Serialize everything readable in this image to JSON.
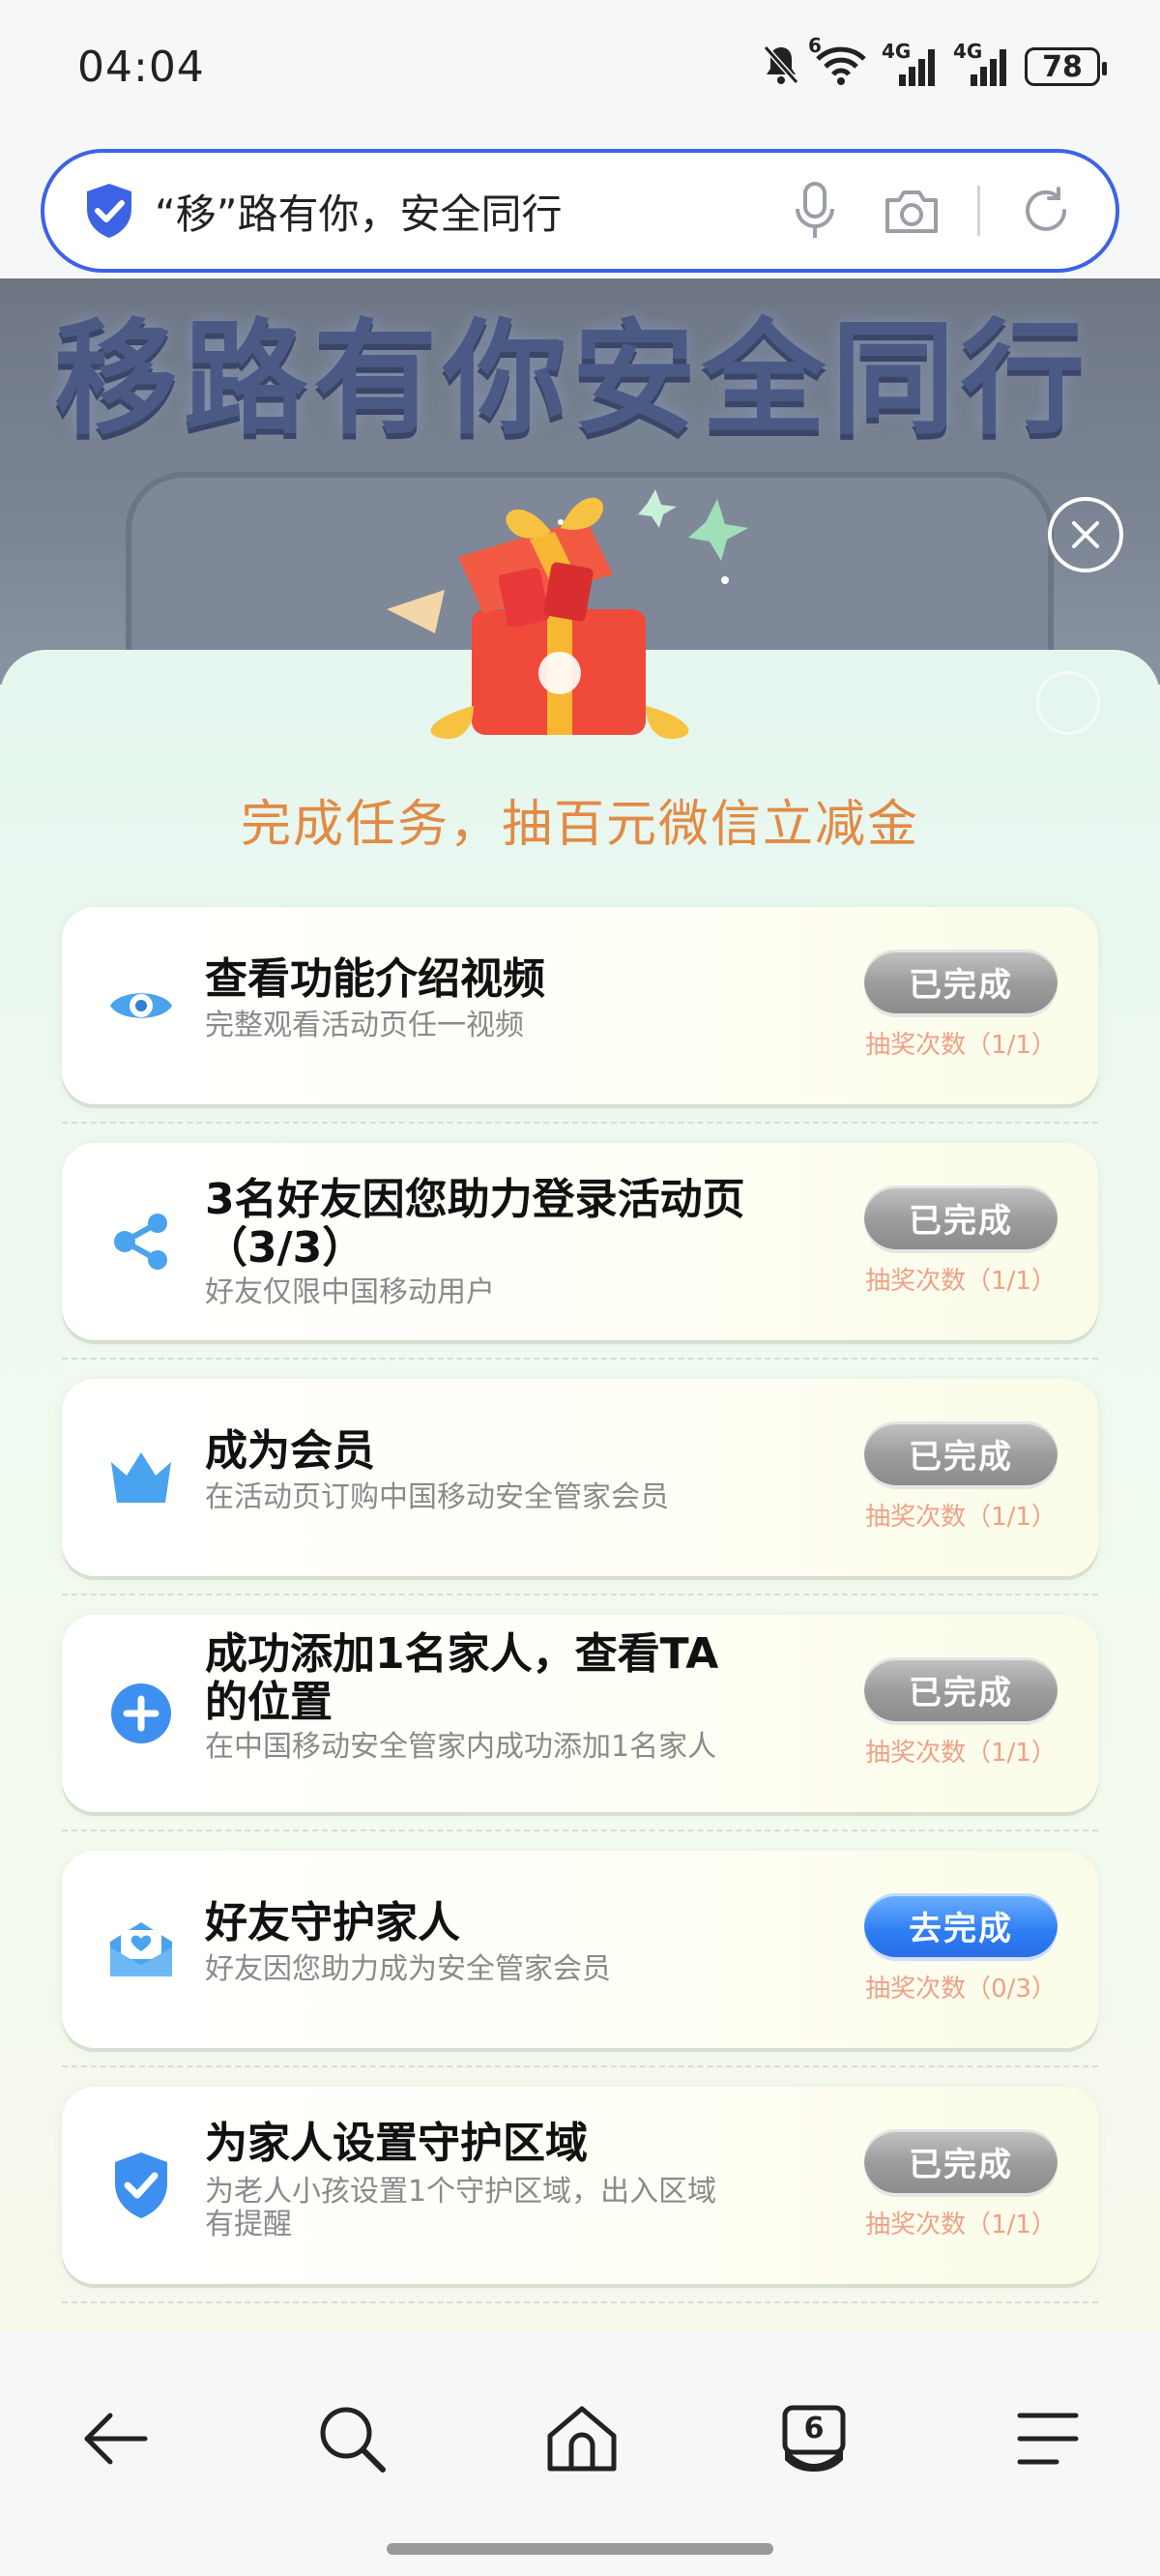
{
  "status_bar": {
    "time": "04:04",
    "network_1": "4G",
    "network_2": "4G",
    "wifi_badge": "6",
    "battery": "78"
  },
  "search": {
    "text": "“移”路有你，安全同行",
    "icons": [
      "shield-icon",
      "microphone-icon",
      "camera-icon",
      "refresh-icon"
    ]
  },
  "hero": {
    "banner_text": "移路有你安全同行"
  },
  "panel": {
    "title": "完成任务，抽百元微信立减金",
    "tasks": [
      {
        "icon": "eye-icon",
        "title": "查看功能介绍视频",
        "subtitle": "完整观看活动页任一视频",
        "button": "已完成",
        "state": "done",
        "count": "抽奖次数（1/1）"
      },
      {
        "icon": "share-icon",
        "title": "3名好友因您助力登录活动页（3/3）",
        "subtitle": "好友仅限中国移动用户",
        "button": "已完成",
        "state": "done",
        "count": "抽奖次数（1/1）"
      },
      {
        "icon": "crown-icon",
        "title": "成为会员",
        "subtitle": "在活动页订购中国移动安全管家会员",
        "button": "已完成",
        "state": "done",
        "count": "抽奖次数（1/1）"
      },
      {
        "icon": "plus-icon",
        "title": "成功添加1名家人，查看TA的位置",
        "subtitle": "在中国移动安全管家内成功添加1名家人",
        "button": "已完成",
        "state": "done",
        "count": "抽奖次数（1/1）"
      },
      {
        "icon": "heart-mail-icon",
        "title": "好友守护家人",
        "subtitle": "好友因您助力成为安全管家会员",
        "button": "去完成",
        "state": "todo",
        "count": "抽奖次数（0/3）"
      },
      {
        "icon": "shield-check-icon",
        "title": "为家人设置守护区域",
        "subtitle": "为老人小孩设置1个守护区域，出入区域有提醒",
        "button": "已完成",
        "state": "done",
        "count": "抽奖次数（1/1）"
      }
    ]
  },
  "bottom_nav": {
    "tabs_count": "6",
    "icons": [
      "back-icon",
      "search-icon",
      "home-icon",
      "tabs-icon",
      "menu-icon"
    ]
  },
  "colors": {
    "accent_blue": "#3c63e6",
    "title_orange": "#e28a44",
    "count_pink": "#f0a086",
    "done_gray": "#9b9b9b",
    "go_blue": "#2d7ef3"
  }
}
